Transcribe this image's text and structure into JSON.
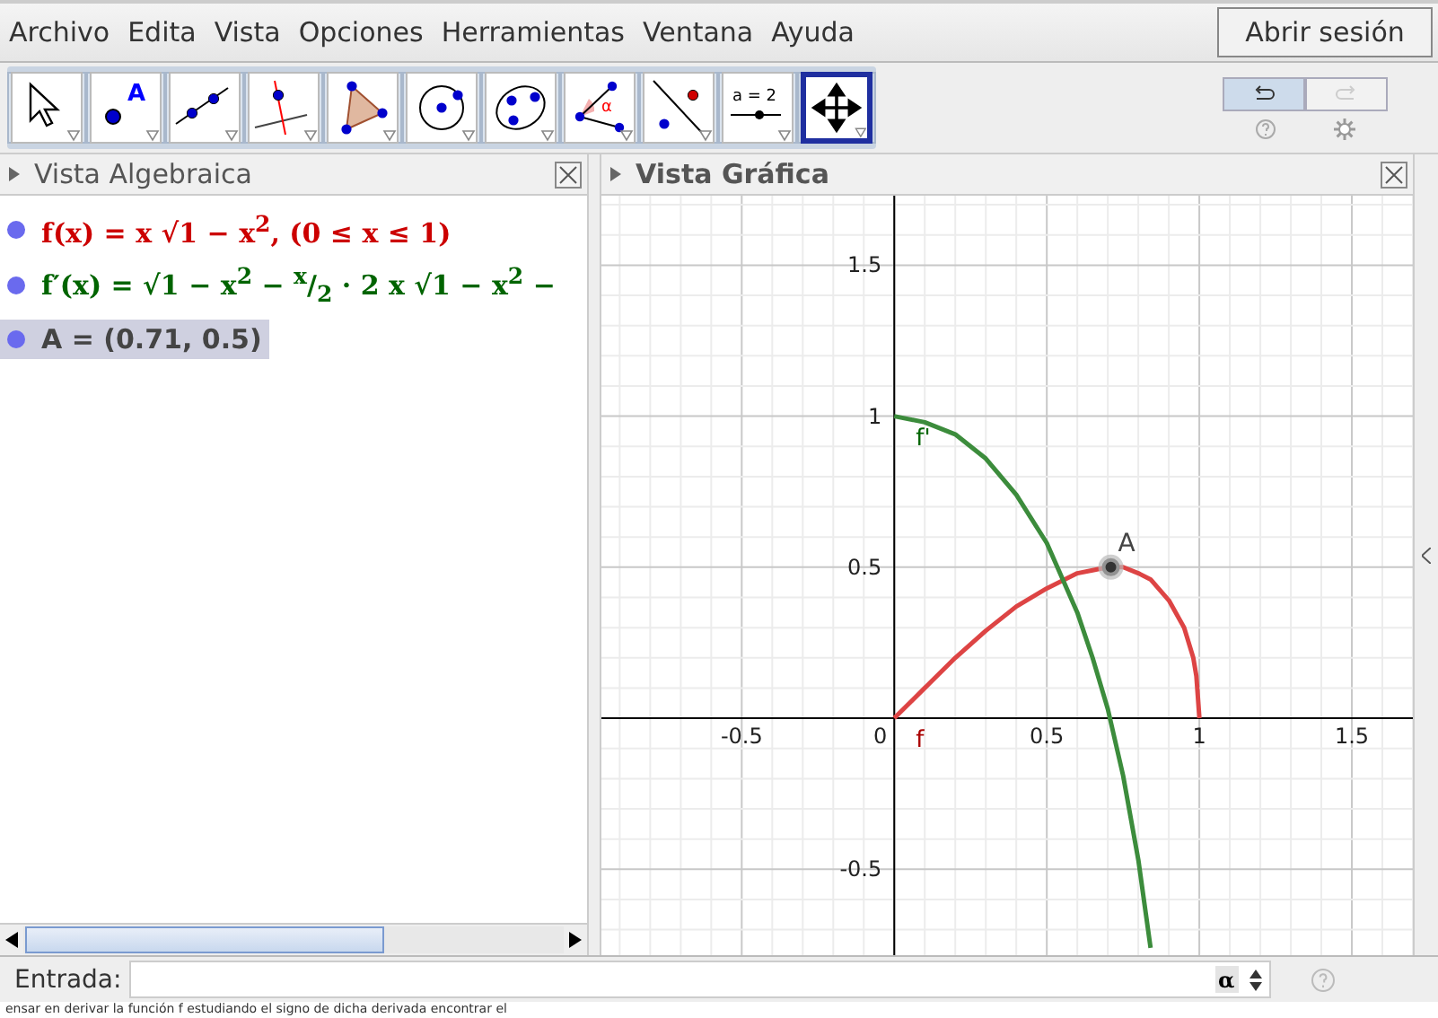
{
  "menu": [
    "Archivo",
    "Edita",
    "Vista",
    "Opciones",
    "Herramientas",
    "Ventana",
    "Ayuda"
  ],
  "login_button": "Abrir sesión",
  "tools": [
    {
      "kind": "pointer",
      "selected": false
    },
    {
      "kind": "point",
      "selected": false,
      "label": "A"
    },
    {
      "kind": "line",
      "selected": false
    },
    {
      "kind": "perpendicular",
      "selected": false
    },
    {
      "kind": "polygon",
      "selected": false
    },
    {
      "kind": "circle",
      "selected": false
    },
    {
      "kind": "conic",
      "selected": false
    },
    {
      "kind": "angle",
      "selected": false,
      "label": "α"
    },
    {
      "kind": "reflect",
      "selected": false
    },
    {
      "kind": "slider",
      "selected": false,
      "label": "a = 2"
    },
    {
      "kind": "move",
      "selected": true
    }
  ],
  "history": [
    {
      "kind": "undo",
      "disabled": false
    },
    {
      "kind": "redo",
      "disabled": true
    }
  ],
  "algebra_view": {
    "title": "Vista Algebraica",
    "items": [
      {
        "text": "f(x) = x √1 − x$^{2}$,   (0 ≤ x ≤ 1)",
        "color": "#cc0000",
        "selected": false
      },
      {
        "text": "f′(x) = √1 − x$^{2}$ − $^{x}$/$_{2}$ · 2 x √1 − x$^{2}$ −",
        "color": "#006400",
        "selected": false
      },
      {
        "text": "A = (0.71, 0.5)",
        "color": "#444444",
        "selected": true
      }
    ]
  },
  "graphics_view": {
    "title": "Vista Gráfica",
    "chart_data": {
      "type": "line",
      "x": [
        0,
        0.1,
        0.2,
        0.3,
        0.4,
        0.5,
        0.6,
        0.65,
        0.7,
        0.75,
        0.8,
        0.84,
        0.9,
        0.95,
        0.98,
        0.99,
        1
      ],
      "series": [
        {
          "name": "f",
          "color": "#dd4444",
          "values": [
            0,
            0.1,
            0.2,
            0.29,
            0.37,
            0.43,
            0.48,
            0.49,
            0.5,
            0.5,
            0.48,
            0.46,
            0.39,
            0.3,
            0.2,
            0.14,
            0
          ]
        },
        {
          "name": "f'",
          "color": "#3c8c3c",
          "values": [
            1,
            0.98,
            0.94,
            0.86,
            0.74,
            0.58,
            0.35,
            0.2,
            0.03,
            -0.19,
            -0.47,
            -0.76,
            null,
            null,
            null,
            null,
            null
          ]
        }
      ],
      "xlim": [
        -0.96,
        1.7
      ],
      "ylim": [
        -0.82,
        1.73
      ],
      "grid": true,
      "xticks": [
        {
          "value": -0.5,
          "label": "-0.5"
        },
        {
          "value": 0.5,
          "label": "0.5"
        },
        {
          "value": 1,
          "label": "1"
        },
        {
          "value": 1.5,
          "label": "1.5"
        }
      ],
      "yticks": [
        {
          "value": -0.5,
          "label": "-0.5"
        },
        {
          "value": 0.5,
          "label": "0.5"
        },
        {
          "value": 1,
          "label": "1"
        },
        {
          "value": 1.5,
          "label": "1.5"
        }
      ],
      "annotations": [
        {
          "text": "A",
          "x": 0.71,
          "y": 0.5
        }
      ]
    },
    "origin_label": "0"
  },
  "input_bar": {
    "label": "Entrada:",
    "alpha_button": "α"
  },
  "background_text": "ensar en derivar la función f estudiando el signo de dicha derivada encontrar el"
}
